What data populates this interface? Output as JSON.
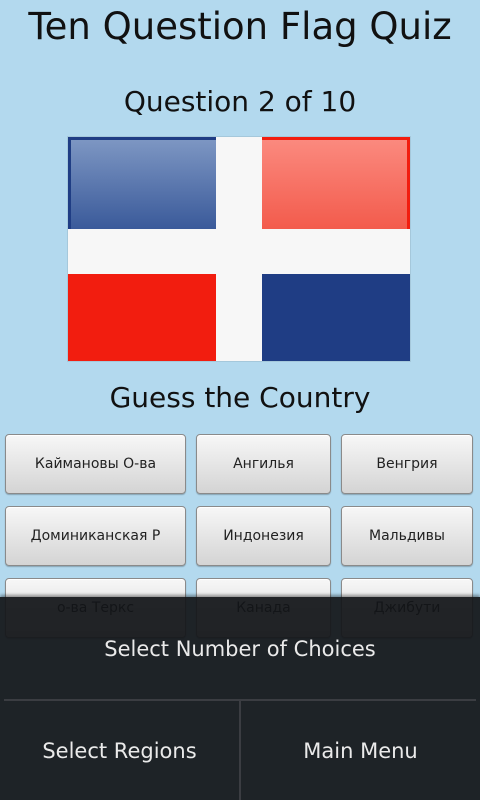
{
  "app_title": "Ten Question Flag Quiz",
  "question_counter": "Question 2 of 10",
  "prompt": "Guess the Country",
  "flag": {
    "icon": "dominican-republic-flag",
    "colors": {
      "blue": "#1f3d84",
      "red": "#f21d0f",
      "white": "#f7f7f7"
    }
  },
  "choices": [
    "Каймановы О-ва",
    "Ангилья",
    "Венгрия",
    "Доминиканская Р",
    "Индонезия",
    "Мальдивы",
    "о-ва Теркс",
    "Канада",
    "Джибути"
  ],
  "menu": {
    "select_choices": "Select Number of Choices",
    "select_regions": "Select Regions",
    "main_menu": "Main Menu"
  }
}
